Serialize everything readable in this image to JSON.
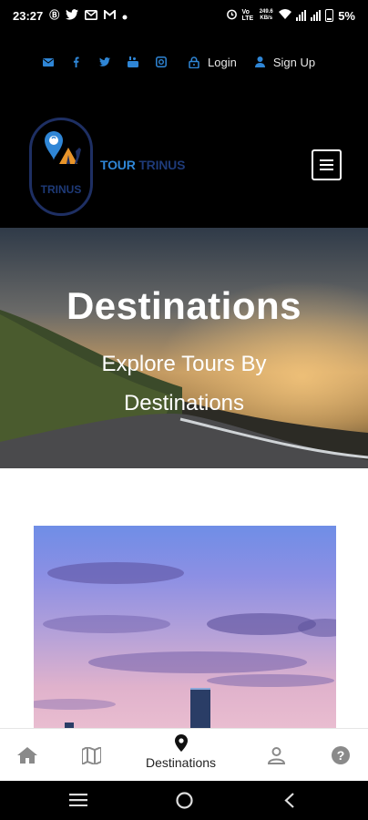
{
  "status_bar": {
    "time": "23:27",
    "speed": "249.6 KB/s",
    "battery": "5%",
    "left_icons": [
      "b-icon",
      "twitter-icon",
      "mail-icon",
      "gmail-icon",
      "dot-icon"
    ],
    "right_icons": [
      "alarm-icon",
      "volte-icon",
      "wifi-icon",
      "signal-icon",
      "signal-icon",
      "battery-icon"
    ]
  },
  "topbar": {
    "social_icons": [
      "email-icon",
      "facebook-icon",
      "twitter-icon",
      "youtube-icon",
      "instagram-icon"
    ],
    "login_label": "Login",
    "signup_label": "Sign Up",
    "accent_color": "#2f86d6"
  },
  "header": {
    "logo_text": "TRINUS",
    "brand_part1": "TOUR",
    "brand_part2": "TRINUS"
  },
  "hero": {
    "title": "Destinations",
    "subtitle": "Explore Tours By Destinations"
  },
  "bottom_nav": {
    "items": [
      {
        "icon": "home-icon",
        "label": ""
      },
      {
        "icon": "map-icon",
        "label": ""
      },
      {
        "icon": "location-pin-icon",
        "label": "Destinations"
      },
      {
        "icon": "person-icon",
        "label": ""
      },
      {
        "icon": "help-icon",
        "label": ""
      }
    ]
  },
  "android_nav": {
    "icons": [
      "recents-icon",
      "home-circle-icon",
      "back-icon"
    ]
  }
}
